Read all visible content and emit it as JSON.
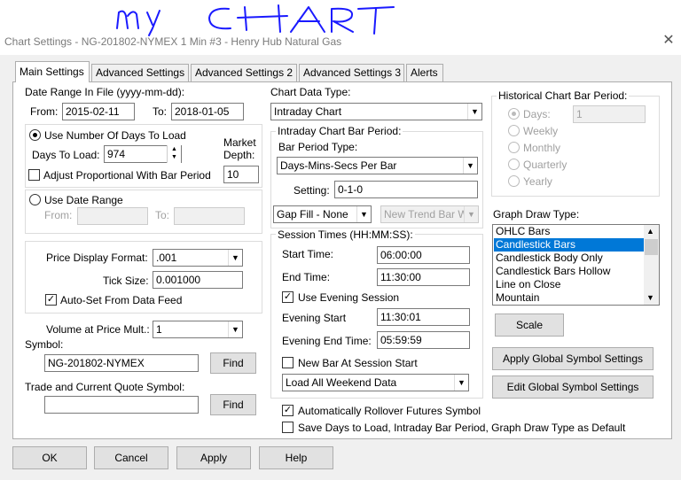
{
  "window": {
    "handwriting": "my CHART",
    "title": "Chart Settings - NG-201802-NYMEX  1 Min  #3 - Henry Hub Natural Gas"
  },
  "tabs": [
    {
      "label": "Main Settings",
      "active": true
    },
    {
      "label": "Advanced Settings"
    },
    {
      "label": "Advanced Settings 2"
    },
    {
      "label": "Advanced Settings 3"
    },
    {
      "label": "Alerts"
    }
  ],
  "date_range": {
    "label": "Date Range In File (yyyy-mm-dd):",
    "from_label": "From:",
    "from_value": "2015-02-11",
    "to_label": "To:",
    "to_value": "2018-01-05"
  },
  "days": {
    "use_days_label": "Use Number Of Days To Load",
    "use_days_checked": true,
    "days_to_load_label": "Days To Load:",
    "days_to_load_value": "974",
    "market_depth_label": "Market Depth:",
    "market_depth_label_1": "Market",
    "market_depth_label_2": "Depth:",
    "market_depth_value": "10",
    "adjust_label": "Adjust Proportional With Bar Period",
    "adjust_checked": false
  },
  "date_range_opt": {
    "label": "Use Date Range",
    "checked": false,
    "from_label": "From:",
    "to_label": "To:"
  },
  "price": {
    "format_label": "Price Display Format:",
    "format_value": ".001",
    "tick_label": "Tick Size:",
    "tick_value": "0.001000",
    "autoset_label": "Auto-Set From Data Feed",
    "autoset_checked": true
  },
  "volume": {
    "label": "Volume at Price Mult.:",
    "value": "1"
  },
  "symbol": {
    "label": "Symbol:",
    "value": "NG-201802-NYMEX",
    "find_label": "Find",
    "trade_label": "Trade and Current Quote Symbol:",
    "trade_value": "",
    "find2_label": "Find"
  },
  "chart_type": {
    "label": "Chart Data Type:",
    "value": "Intraday Chart"
  },
  "intraday": {
    "group_label": "Intraday Chart Bar Period:",
    "bar_type_label": "Bar Period Type:",
    "bar_type_value": "Days-Mins-Secs Per Bar",
    "setting_label": "Setting:",
    "setting_value": "0-1-0",
    "gap_value": "Gap Fill - None",
    "trend_value": "New Trend Bar W"
  },
  "session": {
    "group_label": "Session Times (HH:MM:SS):",
    "start_label": "Start Time:",
    "start_value": "06:00:00",
    "end_label": "End Time:",
    "end_value": "11:30:00",
    "evening_label": "Use Evening Session",
    "evening_checked": true,
    "ev_start_label": "Evening Start",
    "ev_start_value": "11:30:01",
    "ev_end_label": "Evening End Time:",
    "ev_end_value": "05:59:59",
    "newbar_label": "New Bar At Session Start",
    "newbar_checked": false,
    "weekend_value": "Load All Weekend Data"
  },
  "rollover": {
    "label": "Automatically Rollover Futures Symbol",
    "checked": true
  },
  "save_default": {
    "label": "Save Days to Load, Intraday Bar Period, Graph Draw Type as Default",
    "checked": false
  },
  "historical": {
    "group_label": "Historical Chart Bar Period:",
    "days_label": "Days:",
    "days_value": "1",
    "weekly_label": "Weekly",
    "monthly_label": "Monthly",
    "quarterly_label": "Quarterly",
    "yearly_label": "Yearly"
  },
  "graph": {
    "label": "Graph Draw Type:",
    "items": [
      "OHLC Bars",
      "Candlestick Bars",
      "Candlestick Body Only",
      "Candlestick Bars Hollow",
      "Line on Close",
      "Mountain"
    ],
    "selected": "Candlestick Bars"
  },
  "buttons": {
    "scale": "Scale",
    "apply_global": "Apply Global Symbol Settings",
    "edit_global": "Edit Global Symbol Settings",
    "ok": "OK",
    "cancel": "Cancel",
    "apply": "Apply",
    "help": "Help"
  }
}
